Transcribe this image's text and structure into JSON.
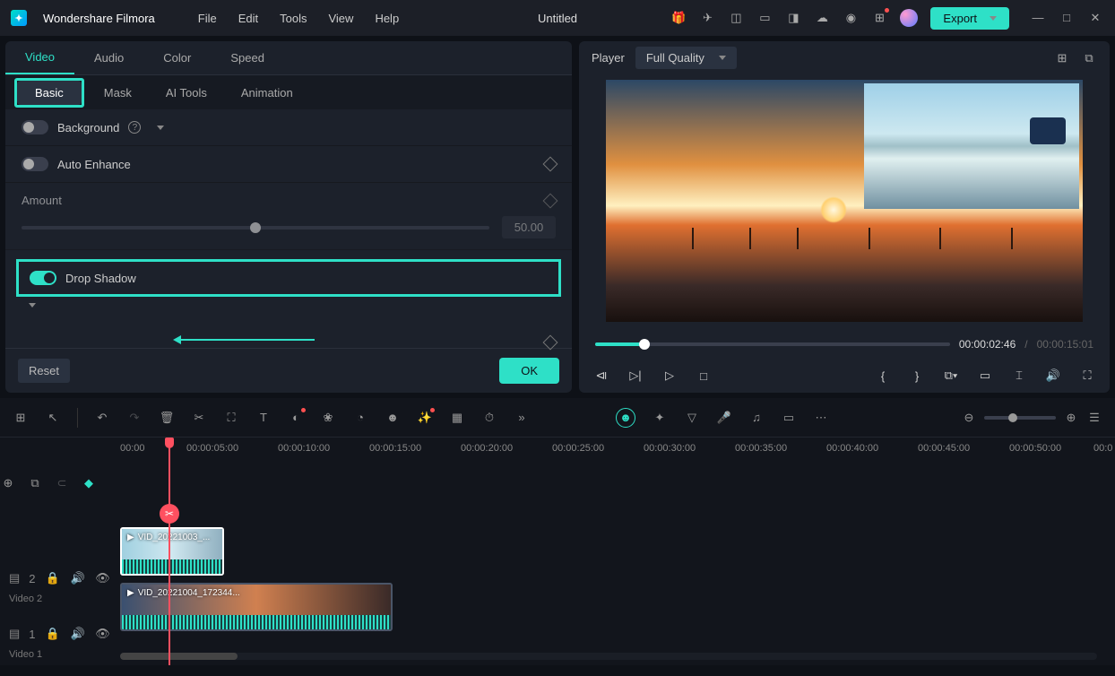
{
  "titlebar": {
    "brand": "Wondershare Filmora",
    "menu": [
      "File",
      "Edit",
      "Tools",
      "View",
      "Help"
    ],
    "doc_title": "Untitled",
    "export_label": "Export"
  },
  "main_tabs": [
    "Video",
    "Audio",
    "Color",
    "Speed"
  ],
  "main_tab_active": 0,
  "sub_tabs": [
    "Basic",
    "Mask",
    "AI Tools",
    "Animation"
  ],
  "sub_tab_active": 0,
  "sections": {
    "background": {
      "label": "Background"
    },
    "auto_enhance": {
      "label": "Auto Enhance"
    },
    "amount": {
      "label": "Amount",
      "value": "50.00"
    },
    "drop_shadow": {
      "label": "Drop Shadow"
    }
  },
  "footer": {
    "reset": "Reset",
    "ok": "OK"
  },
  "player": {
    "label": "Player",
    "quality": "Full Quality",
    "current_time": "00:00:02:46",
    "total_time": "00:00:15:01",
    "sep": "/"
  },
  "ruler_marks": [
    "00:00",
    "00:00:05:00",
    "00:00:10:00",
    "00:00:15:00",
    "00:00:20:00",
    "00:00:25:00",
    "00:00:30:00",
    "00:00:35:00",
    "00:00:40:00",
    "00:00:45:00",
    "00:00:50:00",
    "00:0"
  ],
  "tracks": {
    "video2": {
      "badge": "2",
      "label": "Video 2",
      "clip_name": "VID_20221003_..."
    },
    "video1": {
      "badge": "1",
      "label": "Video 1",
      "clip_name": "VID_20221004_172344..."
    }
  }
}
